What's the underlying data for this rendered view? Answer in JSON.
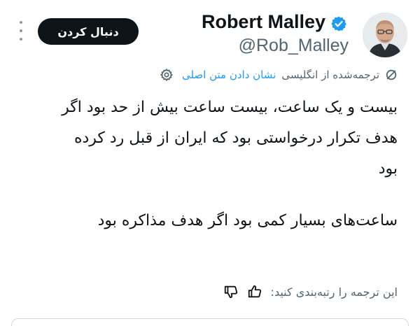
{
  "header": {
    "follow_label": "دنبال کردن",
    "name": "Robert Malley",
    "handle": "@Rob_Malley",
    "verified_color": "#1d9bf0"
  },
  "translation": {
    "status_label": "ترجمه‌شده از انگلیسی",
    "show_original_label": "نشان دادن متن اصلی",
    "link_color": "#1d9bf0"
  },
  "tweet": {
    "lines": [
      "بیست و یک ساعت، بیست ساعت بیش از حد بود اگر",
      "هدف تکرار درخواستی بود که ایران از قبل رد کرده",
      "بود",
      "ساعت‌های بسیار کمی بود اگر هدف مذاکره بود"
    ]
  },
  "rating": {
    "prompt": "این ترجمه را رتبه‌بندی کنید:"
  },
  "icons": {
    "more": "more-vertical-icon",
    "verified": "verified-badge-icon",
    "translate": "translate-icon",
    "settings": "gear-icon",
    "thumbs_up": "thumbs-up-icon",
    "thumbs_down": "thumbs-down-icon"
  }
}
